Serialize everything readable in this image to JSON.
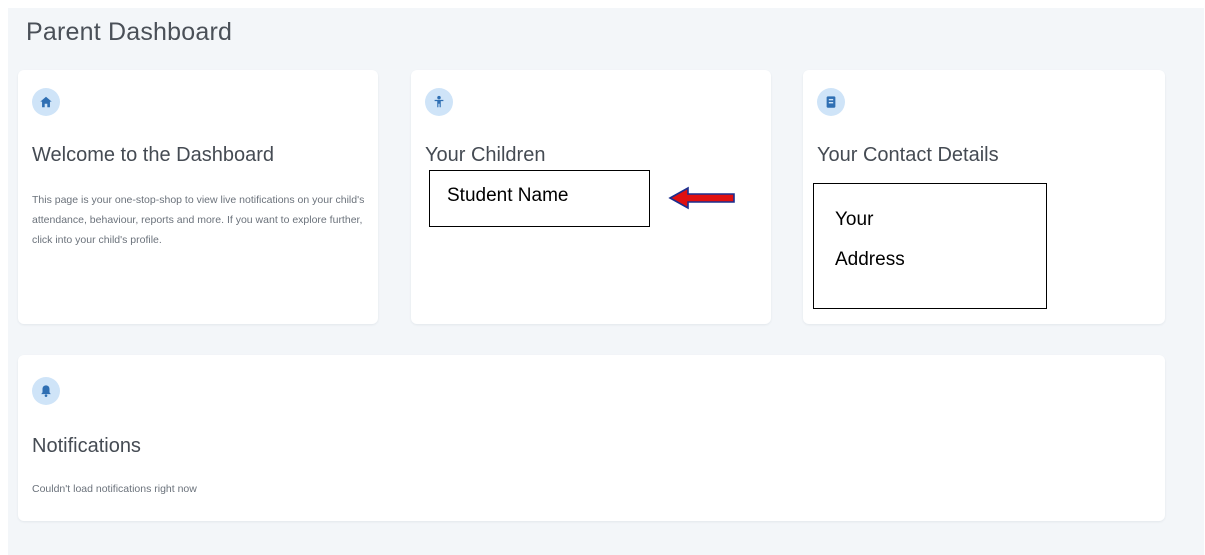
{
  "page": {
    "title": "Parent Dashboard",
    "background": "#f3f6f9"
  },
  "cards": {
    "welcome": {
      "icon": "home-icon",
      "heading": "Welcome to the Dashboard",
      "text": "This page is your one-stop-shop to view live notifications on your child's attendance, behaviour, reports and more. If you want to explore further, click into your child's profile."
    },
    "children": {
      "icon": "child-icon",
      "heading": "Your Children"
    },
    "contact": {
      "icon": "contact-card-icon",
      "heading": "Your Contact Details"
    },
    "notifications": {
      "icon": "bell-icon",
      "heading": "Notifications",
      "text": "Couldn't load notifications right now"
    }
  },
  "overlays": {
    "student_name": "Student Name",
    "address_line1": "Your",
    "address_line2": "Address",
    "arrow_color": "#e01010"
  },
  "colors": {
    "icon_badge": "#cfe4f8",
    "icon_fg": "#2f6fb3"
  }
}
